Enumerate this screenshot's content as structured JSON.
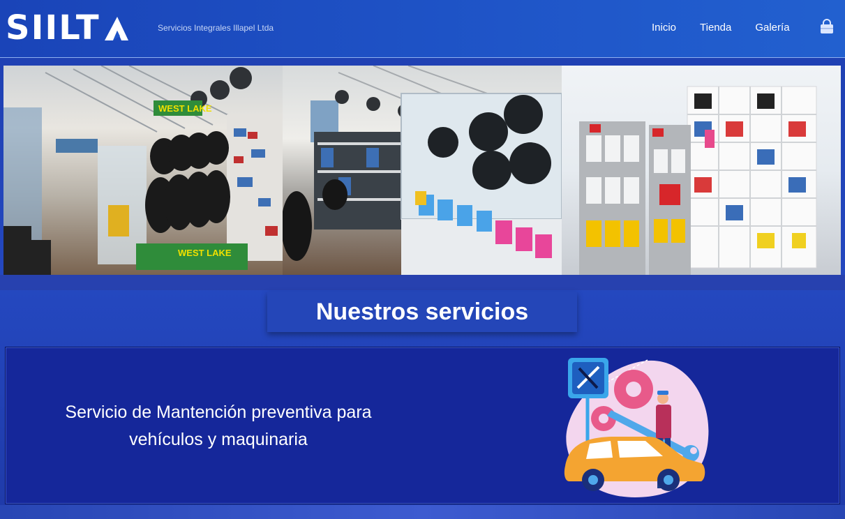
{
  "header": {
    "logo_text": "SIILT",
    "tagline": "Servicios Integrales Illapel Ltda",
    "nav": [
      {
        "label": "Inicio"
      },
      {
        "label": "Tienda"
      },
      {
        "label": "Galería"
      }
    ],
    "cart_icon": "shopping-bag-icon"
  },
  "hero": {
    "photos": [
      {
        "subject": "tire-rack-store-photo"
      },
      {
        "subject": "display-case-store-photo"
      },
      {
        "subject": "oil-shelves-store-photo"
      }
    ],
    "signs": {
      "brand": "WEST LAKE"
    }
  },
  "services": {
    "title": "Nuestros servicios",
    "items": [
      {
        "text_line1": "Servicio de Mantención preventiva para",
        "text_line2": "vehículos y maquinaria",
        "icon": "mechanic-car-repair-illustration"
      }
    ]
  },
  "colors": {
    "header_bg": "#1f55c8",
    "card_bg": "#15279a",
    "accent_orange": "#f4a431",
    "accent_pink": "#e85a8a"
  }
}
